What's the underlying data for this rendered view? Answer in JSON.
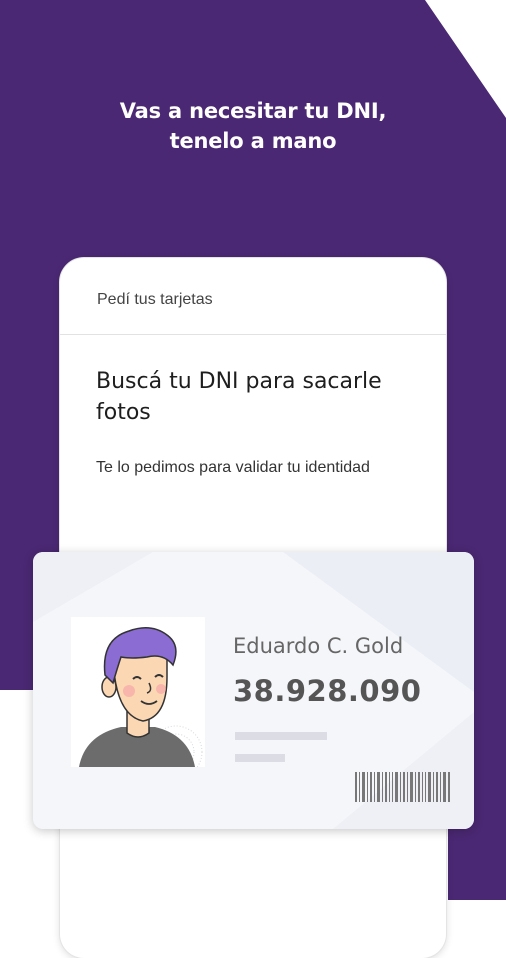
{
  "headline": {
    "line1": "Vas a necesitar tu DNI,",
    "line2": "tenelo a mano"
  },
  "phone": {
    "header_title": "Pedí tus tarjetas",
    "card_title": "Buscá tu DNI para sacarle fotos",
    "card_description": "Te lo pedimos para validar tu identidad"
  },
  "id_card": {
    "name": "Eduardo C. Gold",
    "number": "38.928.090"
  },
  "colors": {
    "brand_purple": "#4b2873",
    "avatar_hair": "#8a6cd3",
    "skin": "#fbd7b4"
  },
  "icons": [
    "avatar-illustration",
    "barcode-icon",
    "seal-icon"
  ]
}
